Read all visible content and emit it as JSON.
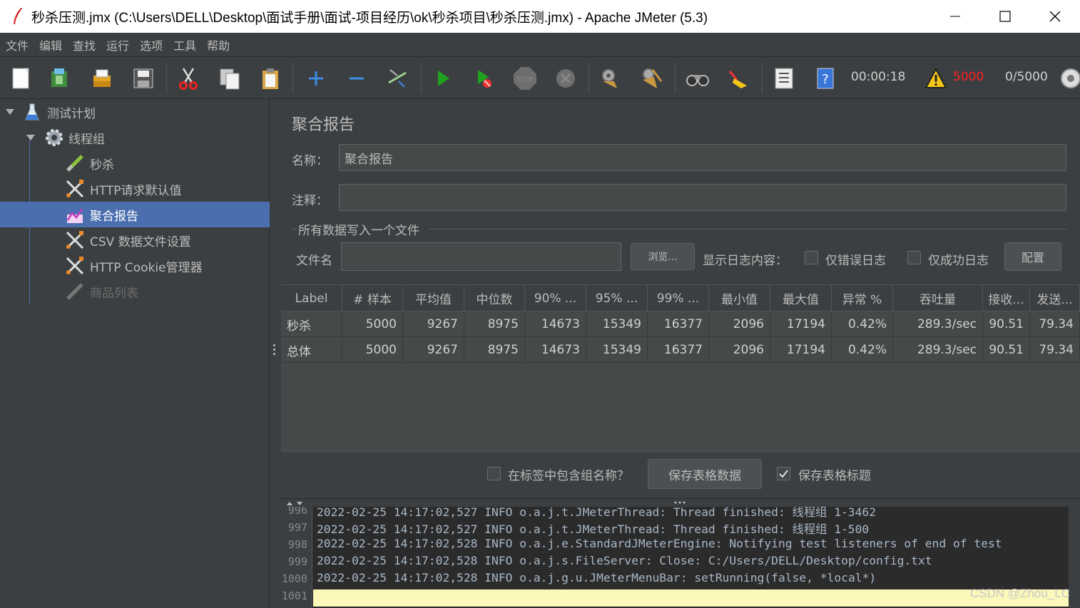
{
  "window": {
    "title": "秒杀压测.jmx (C:\\Users\\DELL\\Desktop\\面试手册\\面试-项目经历\\ok\\秒杀项目\\秒杀压测.jmx) - Apache JMeter (5.3)"
  },
  "menu": [
    "文件",
    "编辑",
    "查找",
    "运行",
    "选项",
    "工具",
    "帮助"
  ],
  "toolbar": {
    "elapsed_time": "00:00:18",
    "error_count": "5000",
    "active_threads": "0/5000",
    "icons": [
      "new-icon",
      "templates-icon",
      "open-icon",
      "save-icon",
      "cut-icon",
      "copy-icon",
      "paste-icon",
      "expand-icon",
      "collapse-icon",
      "toggle-icon",
      "start-icon",
      "start-no-pause-icon",
      "stop-icon",
      "shutdown-icon",
      "clear-icon",
      "clear-all-icon",
      "search-icon",
      "reset-search-icon",
      "function-helper-icon",
      "help-icon",
      "warning-icon",
      "remote-icon"
    ]
  },
  "tree": {
    "items": [
      {
        "label": "测试计划",
        "icon": "test-plan-icon"
      },
      {
        "label": "线程组",
        "icon": "thread-group-icon"
      },
      {
        "label": "秒杀",
        "icon": "sampler-icon"
      },
      {
        "label": "HTTP请求默认值",
        "icon": "config-icon"
      },
      {
        "label": "聚合报告",
        "icon": "report-icon"
      },
      {
        "label": "CSV 数据文件设置",
        "icon": "config-icon"
      },
      {
        "label": "HTTP Cookie管理器",
        "icon": "config-icon"
      },
      {
        "label": "商品列表",
        "icon": "sampler-icon"
      }
    ]
  },
  "panel": {
    "title": "聚合报告",
    "name_label": "名称：",
    "name_value": "聚合报告",
    "comment_label": "注释：",
    "comment_value": "",
    "file_group_title": "所有数据写入一个文件",
    "filename_label": "文件名",
    "filename_value": "",
    "browse_button": "浏览...",
    "log_content_label": "显示日志内容：",
    "errors_only_label": "仅错误日志",
    "success_only_label": "仅成功日志",
    "configure_button": "配置",
    "include_group_label": "在标签中包含组名称？",
    "save_table_button": "保存表格数据",
    "save_header_label": "保存表格标题"
  },
  "table": {
    "headers": [
      "Label",
      "# 样本",
      "平均值",
      "中位数",
      "90% ...",
      "95% ...",
      "99% ...",
      "最小值",
      "最大值",
      "异常 %",
      "吞吐量",
      "接收...",
      "发送..."
    ],
    "rows": [
      [
        "秒杀",
        "5000",
        "9267",
        "8975",
        "14673",
        "15349",
        "16377",
        "2096",
        "17194",
        "0.42%",
        "289.3/sec",
        "90.51",
        "79.34"
      ],
      [
        "总体",
        "5000",
        "9267",
        "8975",
        "14673",
        "15349",
        "16377",
        "2096",
        "17194",
        "0.42%",
        "289.3/sec",
        "90.51",
        "79.34"
      ]
    ]
  },
  "log": {
    "line_numbers": [
      "996",
      "997",
      "998",
      "999",
      "1000",
      "1001"
    ],
    "lines": [
      "2022-02-25 14:17:02,527 INFO o.a.j.t.JMeterThread: Thread finished: 线程组 1-3462",
      "2022-02-25 14:17:02,527 INFO o.a.j.t.JMeterThread: Thread finished: 线程组 1-500",
      "2022-02-25 14:17:02,528 INFO o.a.j.e.StandardJMeterEngine: Notifying test listeners of end of test",
      "2022-02-25 14:17:02,528 INFO o.a.j.s.FileServer: Close: C:/Users/DELL/Desktop/config.txt",
      "2022-02-25 14:17:02,528 INFO o.a.j.g.u.JMeterMenuBar: setRunning(false, *local*)",
      ""
    ],
    "watermark": "CSDN @Zhou_LC"
  },
  "colors": {
    "background": "#3c3f41",
    "selection": "#4b6eaf",
    "error": "#ff0000",
    "log_highlight": "#fbf8ba"
  }
}
